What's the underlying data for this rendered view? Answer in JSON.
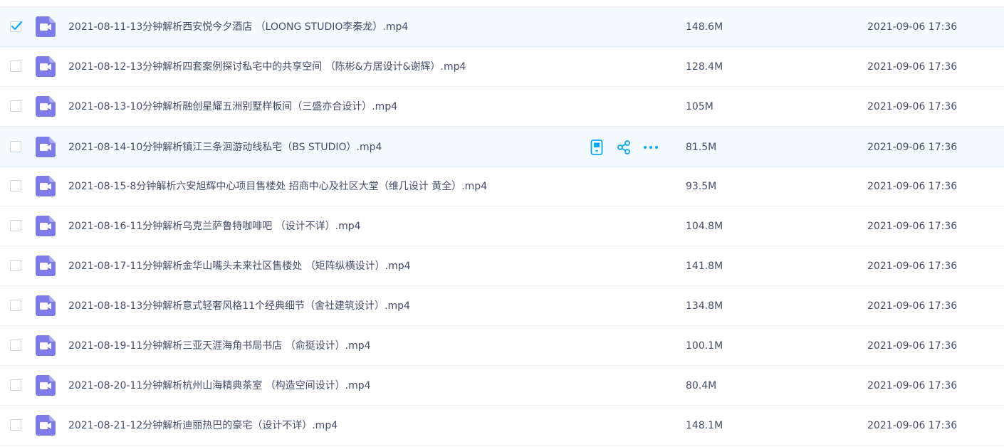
{
  "colors": {
    "accent": "#06a7ff",
    "video_icon": "#7b7ce8",
    "row_highlight": "#f4fbff"
  },
  "files": [
    {
      "name": "2021-08-11-13分钟解析西安悦今夕酒店 （LOONG STUDIO李秦龙）.mp4",
      "size": "148.6M",
      "date": "2021-09-06 17:36",
      "checked": true
    },
    {
      "name": "2021-08-12-13分钟解析四套案例探讨私宅中的共享空间 （陈彬&方居设计&谢辉）.mp4",
      "size": "128.4M",
      "date": "2021-09-06 17:36",
      "checked": false
    },
    {
      "name": "2021-08-13-10分钟解析融创星耀五洲别墅样板间（三盛亦合设计）.mp4",
      "size": "105M",
      "date": "2021-09-06 17:36",
      "checked": false
    },
    {
      "name": "2021-08-14-10分钟解析镇江三条洄游动线私宅（BS STUDIO）.mp4",
      "size": "81.5M",
      "date": "2021-09-06 17:36",
      "checked": false
    },
    {
      "name": "2021-08-15-8分钟解析六安旭辉中心项目售楼处 招商中心及社区大堂（维几设计 黄全）.mp4",
      "size": "93.5M",
      "date": "2021-09-06 17:36",
      "checked": false
    },
    {
      "name": "2021-08-16-11分钟解析乌克兰萨鲁特咖啡吧 （设计不详）.mp4",
      "size": "104.8M",
      "date": "2021-09-06 17:36",
      "checked": false
    },
    {
      "name": "2021-08-17-11分钟解析金华山嘴头未来社区售楼处 （矩阵纵横设计）.mp4",
      "size": "141.8M",
      "date": "2021-09-06 17:36",
      "checked": false
    },
    {
      "name": "2021-08-18-13分钟解析意式轻奢风格11个经典细节（舍社建筑设计）.mp4",
      "size": "134.8M",
      "date": "2021-09-06 17:36",
      "checked": false
    },
    {
      "name": "2021-08-19-11分钟解析三亚天涯海角书局书店 （俞挺设计）.mp4",
      "size": "100.1M",
      "date": "2021-09-06 17:36",
      "checked": false
    },
    {
      "name": "2021-08-20-11分钟解析杭州山海精典茶室 （构造空间设计）.mp4",
      "size": "80.4M",
      "date": "2021-09-06 17:36",
      "checked": false
    },
    {
      "name": "2021-08-21-12分钟解析迪丽热巴的豪宅（设计不详）.mp4",
      "size": "148.1M",
      "date": "2021-09-06 17:36",
      "checked": false
    }
  ],
  "hovered_row": 3,
  "hover_actions": [
    {
      "icon": "phone-icon",
      "label": ""
    },
    {
      "icon": "share-icon",
      "label": ""
    },
    {
      "icon": "more-icon",
      "label": ""
    }
  ]
}
